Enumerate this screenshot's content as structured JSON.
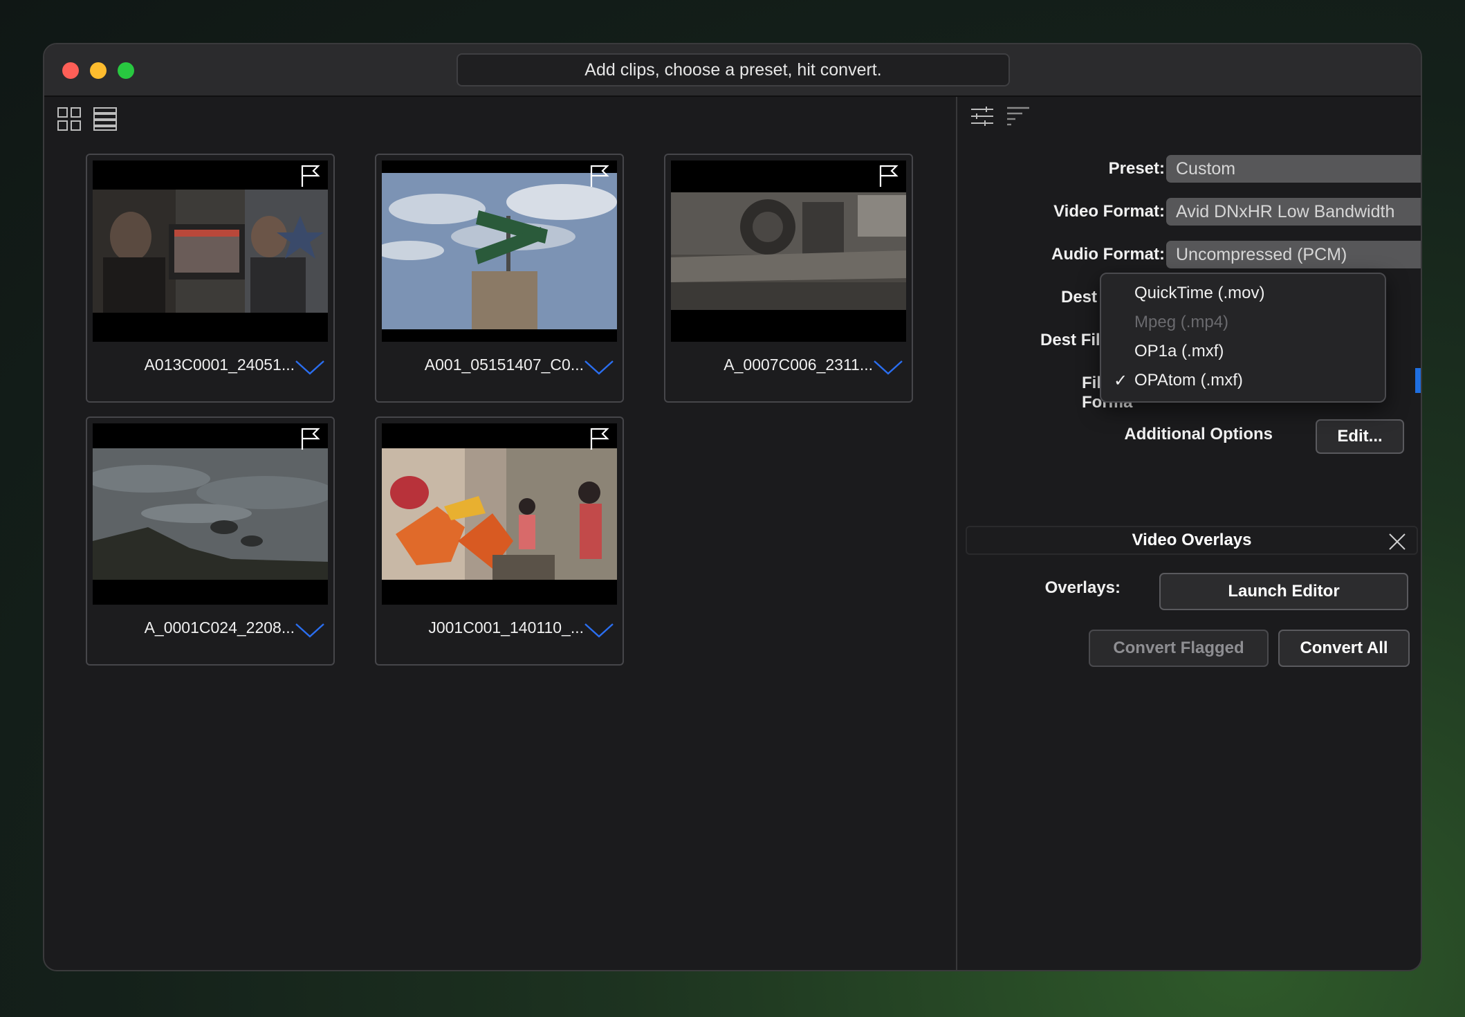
{
  "window": {
    "title_hint": "Add clips, choose a preset, hit convert."
  },
  "clips": [
    {
      "name": "A013C0001_24051..."
    },
    {
      "name": "A001_05151407_C0..."
    },
    {
      "name": "A_0007C006_2311..."
    },
    {
      "name": "A_0001C024_2208..."
    },
    {
      "name": "J001C001_140110_..."
    }
  ],
  "settings": {
    "preset_label": "Preset:",
    "preset_value": "Custom",
    "video_format_label": "Video Format:",
    "video_format_value": "Avid DNxHR Low Bandwidth",
    "audio_format_label": "Audio Format:",
    "audio_format_value": "Uncompressed (PCM)",
    "dest_folder_label": "Dest Folde",
    "dest_file_name_label": "Dest File Nam",
    "file_format_label": "File Forma",
    "additional_options_label": "Additional Options",
    "edit_button": "Edit..."
  },
  "file_format_menu": {
    "items": [
      {
        "label": "QuickTime (.mov)",
        "enabled": true,
        "checked": false
      },
      {
        "label": "Mpeg (.mp4)",
        "enabled": false,
        "checked": false
      },
      {
        "label": "OP1a (.mxf)",
        "enabled": true,
        "checked": false
      },
      {
        "label": "OPAtom (.mxf)",
        "enabled": true,
        "checked": true
      }
    ],
    "check_mark": "✓"
  },
  "overlays": {
    "section_title": "Video Overlays",
    "overlays_label": "Overlays:",
    "launch_editor": "Launch Editor"
  },
  "actions": {
    "convert_flagged": "Convert Flagged",
    "convert_all": "Convert All"
  },
  "colors": {
    "accent": "#1f6fe0",
    "chevron": "#2a6ef0"
  }
}
